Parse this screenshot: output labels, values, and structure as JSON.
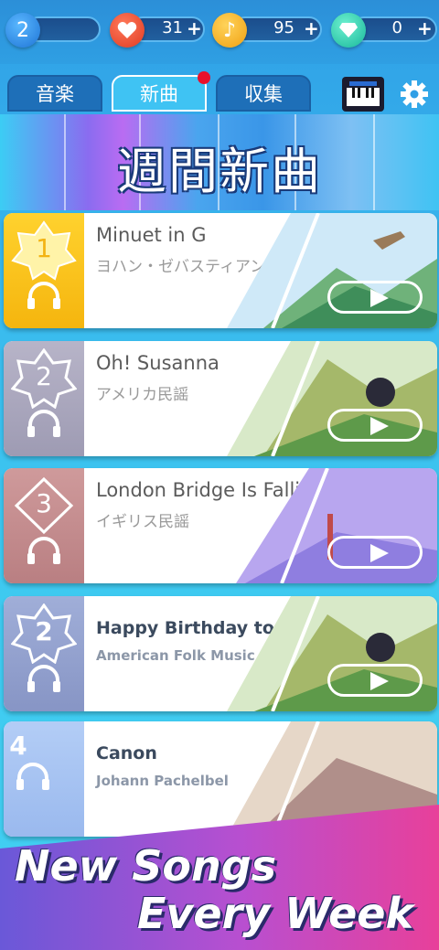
{
  "header": {
    "level": "2",
    "lives": "31",
    "notes": "95",
    "gems": "0",
    "plus": "+"
  },
  "tabs": [
    {
      "label": "音楽"
    },
    {
      "label": "新曲"
    },
    {
      "label": "収集"
    }
  ],
  "banner": {
    "title": "週間新曲"
  },
  "songs": [
    {
      "rank": "1",
      "name": "Minuet in G",
      "artist": "ヨハン・ゼバスティアン・バッハ"
    },
    {
      "rank": "2",
      "name": "Oh! Susanna",
      "artist": "アメリカ民謡"
    },
    {
      "rank": "3",
      "name": "London Bridge Is Falling Down",
      "artist": "イギリス民謡"
    },
    {
      "rank": "2",
      "name": "Happy Birthday to You",
      "artist": "American Folk Music"
    },
    {
      "rank": "4",
      "name": "Canon",
      "artist": "Johann Pachelbel"
    }
  ],
  "promo": {
    "line1": "New Songs",
    "line2": "Every Week"
  },
  "colors": {
    "rank1": "#f7c21a",
    "rank2": "#a9a6bd",
    "rank3": "#c48c8e",
    "rank_alt": "#93a2cf",
    "rank4": "#a7c4f2",
    "accent": "#3fc3f3",
    "notification": "#e8102a"
  },
  "icons": [
    "level-badge-icon",
    "heart-icon",
    "music-note-icon",
    "diamond-icon",
    "piano-icon",
    "gear-icon",
    "headphones-icon",
    "play-icon"
  ]
}
